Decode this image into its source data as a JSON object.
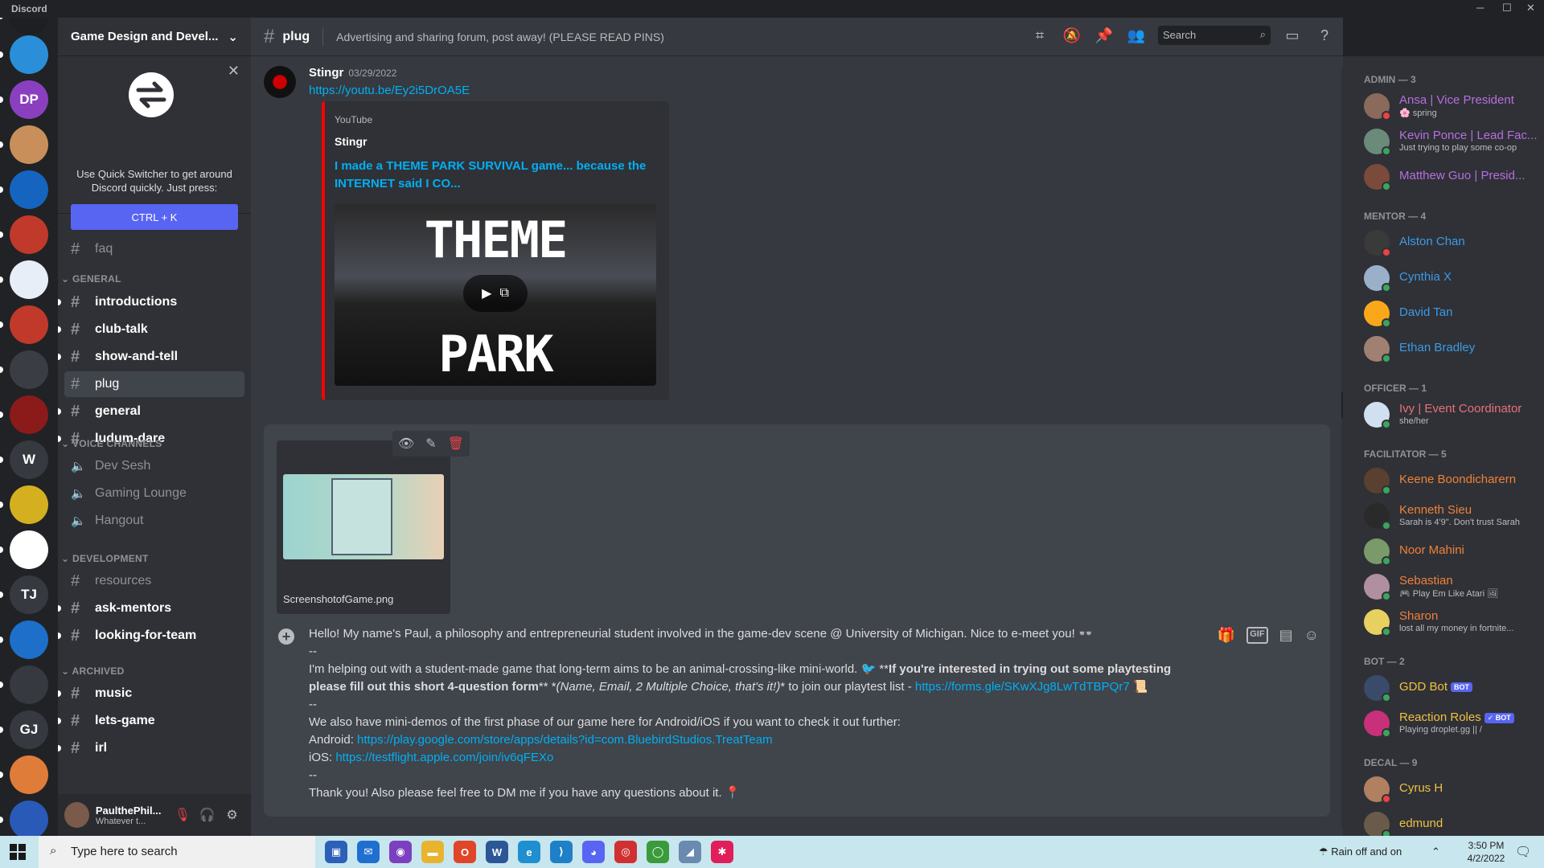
{
  "app": {
    "title": "Discord",
    "window_controls": [
      "─",
      "☐",
      "✕"
    ]
  },
  "servers": [
    {
      "label": "",
      "color": "#1e1f22"
    },
    {
      "label": "",
      "color": "#2a8fd8"
    },
    {
      "label": "DP",
      "color": "#8a3fbf"
    },
    {
      "label": "",
      "color": "#c98f5a"
    },
    {
      "label": "",
      "color": "#1565c0"
    },
    {
      "label": "",
      "color": "#c0392b"
    },
    {
      "label": "",
      "color": "#e8eef8"
    },
    {
      "label": "",
      "color": "#c0392b"
    },
    {
      "label": "",
      "color": "#3a3d44"
    },
    {
      "label": "",
      "color": "#8b1a1a"
    },
    {
      "label": "W",
      "color": "#36393f"
    },
    {
      "label": "",
      "color": "#d4b020"
    },
    {
      "label": "",
      "color": "#ffffff"
    },
    {
      "label": "TJ",
      "color": "#36393f"
    },
    {
      "label": "",
      "color": "#1d6fc9"
    },
    {
      "label": "",
      "color": "#36393f"
    },
    {
      "label": "GJ",
      "color": "#36393f"
    },
    {
      "label": "",
      "color": "#e07c3a"
    },
    {
      "label": "",
      "color": "#2a5ab8"
    }
  ],
  "guild": {
    "name": "Game Design and Devel..."
  },
  "quick_switcher": {
    "text": "Use Quick Switcher to get around Discord quickly. Just press:",
    "button": "CTRL + K"
  },
  "channels": {
    "faq": "faq",
    "cat_general": "GENERAL",
    "general": [
      "introductions",
      "club-talk",
      "show-and-tell",
      "plug",
      "general",
      "ludum-dare"
    ],
    "cat_voice": "VOICE CHANNELS",
    "voice": [
      "Dev Sesh",
      "Gaming Lounge",
      "Hangout"
    ],
    "cat_dev": "DEVELOPMENT",
    "dev": [
      "resources",
      "ask-mentors",
      "looking-for-team"
    ],
    "cat_arch": "ARCHIVED",
    "arch": [
      "music",
      "lets-game",
      "irl"
    ]
  },
  "user": {
    "name": "PaulthePhil...",
    "status": "Whatever t..."
  },
  "header": {
    "channel": "plug",
    "topic": "Advertising and sharing forum, post away! (PLEASE READ PINS)",
    "search": "Search"
  },
  "message": {
    "author": "Stingr",
    "timestamp": "03/29/2022",
    "link": "https://youtu.be/Ey2i5DrOA5E",
    "embed": {
      "provider": "YouTube",
      "author": "Stingr",
      "title": "I made a THEME PARK SURVIVAL game... because the INTERNET said I CO...",
      "thumb_top": "THEME",
      "thumb_bottom": "PARK"
    }
  },
  "composer": {
    "attachment_name": "ScreenshotofGame.png",
    "line1": "Hello! My name's Paul, a philosophy and entrepreneurial student involved in the game-dev scene @ University of Michigan. Nice to e-meet you! 👓",
    "sep": "--",
    "line2a": "I'm helping out with a student-made game that long-term aims to be an animal-crossing-like mini-world. 🐦 **",
    "line2b": "If you're interested in trying out some playtesting",
    "line3a": "please fill out this short 4-question form",
    "line3b": "** *",
    "line3c": "(Name, Email, 2 Multiple Choice, that's it!)",
    "line3d": "* to join our playtest list - ",
    "line3link": "https://forms.gle/SKwXJg8LwTdTBPQr7",
    "line3e": " 📜",
    "line4": "We also have mini-demos of the first phase of our game here for Android/iOS if you want to check it out further:",
    "android_label": "Android: ",
    "android_link": "https://play.google.com/store/apps/details?id=com.BluebirdStudios.TreatTeam",
    "ios_label": "iOS: ",
    "ios_link": "https://testflight.apple.com/join/iv6qFEXo",
    "line5": "Thank you! Also please feel free to DM me if you have any questions about it. 📍",
    "gif": "GIF"
  },
  "members": {
    "cats": [
      "ADMIN — 3",
      "MENTOR — 4",
      "OFFICER — 1",
      "FACILITATOR — 5",
      "BOT — 2",
      "DECAL — 9"
    ],
    "admin": [
      {
        "name": "Ansa | Vice President",
        "sub": "🌸 spring",
        "color": "#b76ee0",
        "av": "#8a6a5a",
        "st": "#ed4245"
      },
      {
        "name": "Kevin Ponce | Lead Fac...",
        "sub": "Just trying to play some co-op",
        "color": "#b76ee0",
        "av": "#6a8a7a",
        "st": "#3ba55d"
      },
      {
        "name": "Matthew Guo | Presid...",
        "sub": "",
        "color": "#b76ee0",
        "av": "#7a4a3a",
        "st": "#3ba55d"
      }
    ],
    "mentor": [
      {
        "name": "Alston Chan",
        "color": "#3b9be8",
        "av": "#3a3a3a",
        "st": "#ed4245"
      },
      {
        "name": "Cynthia X",
        "color": "#3b9be8",
        "av": "#9ab0c8",
        "st": "#3ba55d"
      },
      {
        "name": "David Tan",
        "color": "#3b9be8",
        "av": "#faa81a",
        "st": "#3ba55d"
      },
      {
        "name": "Ethan Bradley",
        "color": "#3b9be8",
        "av": "#a08070",
        "st": "#3ba55d"
      }
    ],
    "officer": [
      {
        "name": "Ivy | Event Coordinator",
        "sub": "she/her",
        "color": "#e9707a",
        "av": "#d0e0f0",
        "st": "#3ba55d"
      }
    ],
    "facilitator": [
      {
        "name": "Keene Boondicharern",
        "sub": "",
        "color": "#f0803a",
        "av": "#5a4030",
        "st": "#3ba55d"
      },
      {
        "name": "Kenneth Sieu",
        "sub": "Sarah is 4'9\". Don't trust Sarah",
        "color": "#f0803a",
        "av": "#2a2a2a",
        "st": "#3ba55d"
      },
      {
        "name": "Noor Mahini",
        "sub": "",
        "color": "#f0803a",
        "av": "#7a9a6a",
        "st": "#3ba55d"
      },
      {
        "name": "Sebastian",
        "sub": "🎮 Play Em Like Atari 🖼",
        "color": "#f0803a",
        "av": "#b090a0",
        "st": "#3ba55d"
      },
      {
        "name": "Sharon",
        "sub": "lost all my money in fortnite...",
        "color": "#f0803a",
        "av": "#e8d060",
        "st": "#3ba55d"
      }
    ],
    "bots": [
      {
        "name": "GDD Bot",
        "sub": "",
        "tag": "BOT",
        "color": "#f0c040",
        "av": "#3a4a6a",
        "st": "#3ba55d"
      },
      {
        "name": "Reaction Roles",
        "sub": "Playing droplet.gg || /",
        "tag": "✓ BOT",
        "color": "#f0c040",
        "av": "#c8307a",
        "st": "#3ba55d"
      }
    ],
    "decal": [
      {
        "name": "Cyrus H",
        "color": "#f0c040",
        "av": "#b08060",
        "st": "#ed4245"
      },
      {
        "name": "edmund",
        "color": "#f0c040",
        "av": "#6a5a4a",
        "st": "#3ba55d"
      }
    ]
  },
  "taskbar": {
    "search": "Type here to search",
    "weather": "Rain off and on",
    "time": "3:50 PM",
    "date": "4/2/2022"
  }
}
